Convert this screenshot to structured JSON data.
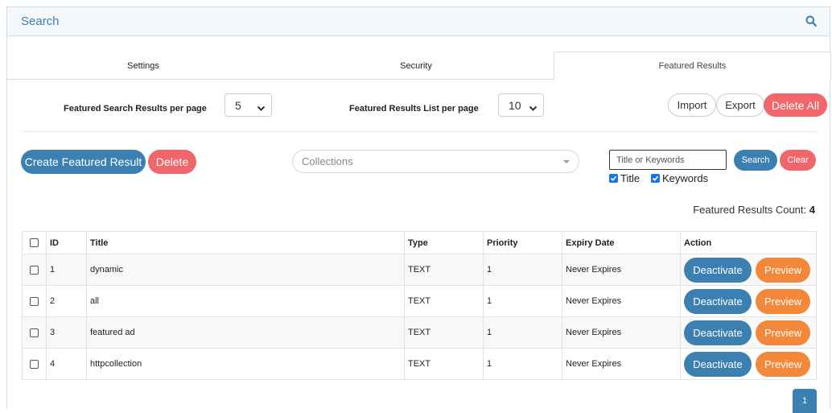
{
  "header": {
    "title": "Search"
  },
  "tabs": [
    {
      "label": "Settings"
    },
    {
      "label": "Security"
    },
    {
      "label": "Featured Results"
    }
  ],
  "settings": {
    "per_page_label": "Featured Search Results per page",
    "per_page_value": "5",
    "list_per_page_label": "Featured Results List per page",
    "list_per_page_value": "10",
    "import_label": "Import",
    "export_label": "Export",
    "delete_all_label": "Delete All"
  },
  "toolbar": {
    "create_label": "Create Featured Result",
    "delete_label": "Delete",
    "collections_placeholder": "Collections",
    "keyword_placeholder": "Title or Keywords",
    "search_label": "Search",
    "clear_label": "Clear",
    "filter_title_label": "Title",
    "filter_keywords_label": "Keywords"
  },
  "count": {
    "label": "Featured Results Count:",
    "value": "4"
  },
  "table": {
    "headers": [
      "ID",
      "Title",
      "Type",
      "Priority",
      "Expiry Date",
      "Action"
    ],
    "rows": [
      {
        "id": "1",
        "title": "dynamic",
        "type": "TEXT",
        "priority": "1",
        "expiry": "Never Expires"
      },
      {
        "id": "2",
        "title": "all",
        "type": "TEXT",
        "priority": "1",
        "expiry": "Never Expires"
      },
      {
        "id": "3",
        "title": "featured ad",
        "type": "TEXT",
        "priority": "1",
        "expiry": "Never Expires"
      },
      {
        "id": "4",
        "title": "httpcollection",
        "type": "TEXT",
        "priority": "1",
        "expiry": "Never Expires"
      }
    ],
    "deactivate_label": "Deactivate",
    "preview_label": "Preview"
  },
  "pagination": {
    "current": "1"
  },
  "colors": {
    "primary": "#3b80b0",
    "danger": "#f0666b",
    "warning": "#f4883a",
    "header_bg": "#f5f8fb"
  }
}
